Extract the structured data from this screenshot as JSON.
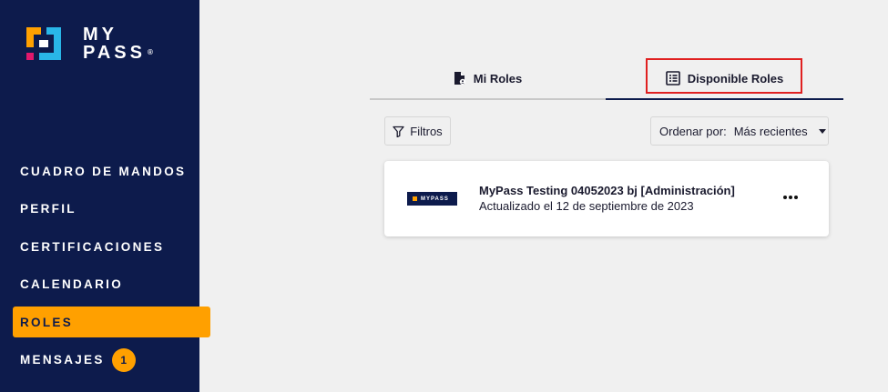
{
  "brand": {
    "line1": "MY",
    "line2": "PASS",
    "reg": "®"
  },
  "nav": [
    {
      "label": "CUADRO DE MANDOS"
    },
    {
      "label": "PERFIL"
    },
    {
      "label": "CERTIFICACIONES"
    },
    {
      "label": "CALENDARIO"
    },
    {
      "label": "ROLES",
      "active": true
    },
    {
      "label": "MENSAJES",
      "badge": "1"
    }
  ],
  "tabs": {
    "mine": "Mi Roles",
    "available": "Disponible Roles"
  },
  "filters": {
    "label": "Filtros"
  },
  "sort": {
    "label": "Ordenar por:",
    "value": "Más recientes"
  },
  "card": {
    "logo_text": "MYPASS",
    "title": "MyPass Testing 04052023 bj [Administración]",
    "subtitle": "Actualizado el 12 de septiembre de 2023"
  },
  "colors": {
    "sidebar": "#0d1b4c",
    "accent": "#ffa000",
    "highlight": "#e02020"
  }
}
